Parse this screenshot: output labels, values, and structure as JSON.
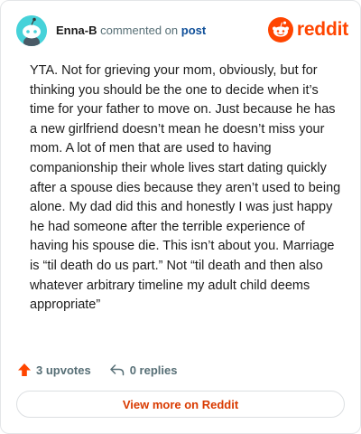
{
  "header": {
    "username": "Enna-B",
    "action_text": "commented on",
    "post_link": "post",
    "brand": "reddit"
  },
  "comment": {
    "text": "YTA. Not for grieving your mom, obviously, but for thinking you should be the one to decide when it’s time for your father to move on. Just because he has a new girlfriend doesn’t mean he doesn’t miss your mom. A lot of men that are used to having companionship their whole lives start dating quickly after a spouse dies because they aren’t used to being alone. My dad did this and honestly I was just happy he had someone after the terrible experience of having his spouse die. This isn’t about you. Marriage is “til death do us part.” Not “til death and then also whatever arbitrary timeline my adult child deems appropriate”"
  },
  "actions": {
    "upvotes": "3 upvotes",
    "replies": "0 replies"
  },
  "footer": {
    "view_more": "View more on Reddit"
  },
  "colors": {
    "brand": "#ff4500",
    "avatar_bg": "#46d2d9",
    "link": "#0f4f99",
    "view_more": "#d93a00"
  },
  "icons": {
    "avatar": "snoo-avatar-icon",
    "brand": "reddit-logo-icon",
    "upvote": "upvote-arrow-icon",
    "reply": "reply-arrow-icon"
  }
}
